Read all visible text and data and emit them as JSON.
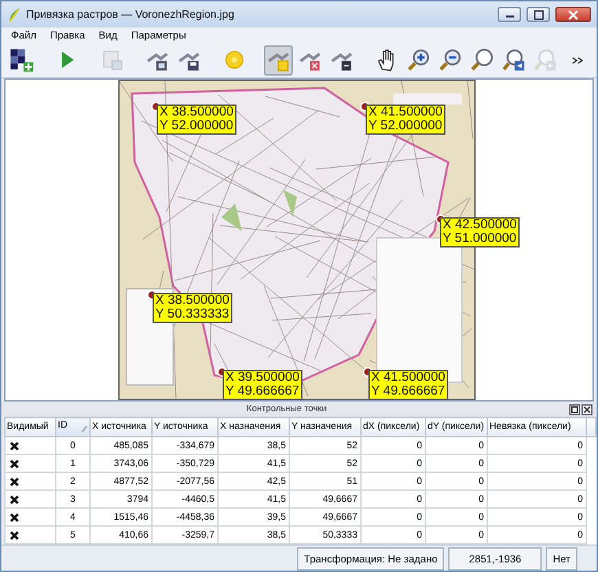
{
  "window": {
    "title": "Привязка растров — VoronezhRegion.jpg"
  },
  "menu": [
    "Файл",
    "Правка",
    "Вид",
    "Параметры"
  ],
  "toolbar": [
    {
      "kind": "raster",
      "selected": false,
      "disabled": false
    },
    {
      "kind": "play",
      "selected": false,
      "disabled": false
    },
    {
      "kind": "report",
      "selected": false,
      "disabled": true
    },
    {
      "kind": "load-points",
      "selected": false,
      "disabled": false
    },
    {
      "kind": "save-points",
      "selected": false,
      "disabled": false
    },
    {
      "kind": "settings",
      "selected": false,
      "disabled": false
    },
    {
      "kind": "add-point",
      "selected": true,
      "disabled": false
    },
    {
      "kind": "delete-point",
      "selected": false,
      "disabled": false
    },
    {
      "kind": "move-point",
      "selected": false,
      "disabled": false
    },
    {
      "kind": "pan",
      "selected": false,
      "disabled": false
    },
    {
      "kind": "zoom-in",
      "selected": false,
      "disabled": false
    },
    {
      "kind": "zoom-out",
      "selected": false,
      "disabled": false
    },
    {
      "kind": "zoom-full",
      "selected": false,
      "disabled": false
    },
    {
      "kind": "zoom-last",
      "selected": false,
      "disabled": false
    },
    {
      "kind": "zoom-next",
      "selected": false,
      "disabled": true
    },
    {
      "kind": "more",
      "selected": false,
      "disabled": false
    }
  ],
  "points": [
    {
      "x": "X 38.500000",
      "y": "Y 52.000000"
    },
    {
      "x": "X 41.500000",
      "y": "Y 52.000000"
    },
    {
      "x": "X 42.500000",
      "y": "Y 51.000000"
    },
    {
      "x": "X 38.500000",
      "y": "Y 50.333333"
    },
    {
      "x": "X 39.500000",
      "y": "Y 49.666667"
    },
    {
      "x": "X 41.500000",
      "y": "Y 49.666667"
    }
  ],
  "dock": {
    "title": "Контрольные точки"
  },
  "table": {
    "columns": [
      {
        "label": "Видимый",
        "sorted": false
      },
      {
        "label": "ID",
        "sorted": true
      },
      {
        "label": "X источника",
        "sorted": false
      },
      {
        "label": "Y источника",
        "sorted": false
      },
      {
        "label": "X назначения",
        "sorted": false
      },
      {
        "label": "Y назначения",
        "sorted": false
      },
      {
        "label": "dX (пиксели)",
        "sorted": false
      },
      {
        "label": "dY (пиксели)",
        "sorted": false
      },
      {
        "label": "Невязка (пиксели)",
        "sorted": false
      }
    ],
    "rows": [
      {
        "visible": true,
        "cells": [
          "",
          "0",
          "485,085",
          "-334,679",
          "38,5",
          "52",
          "0",
          "0",
          "0"
        ]
      },
      {
        "visible": true,
        "cells": [
          "",
          "1",
          "3743,06",
          "-350,729",
          "41,5",
          "52",
          "0",
          "0",
          "0"
        ]
      },
      {
        "visible": true,
        "cells": [
          "",
          "2",
          "4877,52",
          "-2077,56",
          "42,5",
          "51",
          "0",
          "0",
          "0"
        ]
      },
      {
        "visible": true,
        "cells": [
          "",
          "3",
          "3794",
          "-4460,5",
          "41,5",
          "49,6667",
          "0",
          "0",
          "0"
        ]
      },
      {
        "visible": true,
        "cells": [
          "",
          "4",
          "1515,46",
          "-4458,36",
          "39,5",
          "49,6667",
          "0",
          "0",
          "0"
        ]
      },
      {
        "visible": true,
        "cells": [
          "",
          "5",
          "410,66",
          "-3259,7",
          "38,5",
          "50,3333",
          "0",
          "0",
          "0"
        ]
      }
    ]
  },
  "status_bar": {
    "transform": "Трансформация: Не задано",
    "coords": "2851,-1936",
    "crs": "Нет"
  }
}
